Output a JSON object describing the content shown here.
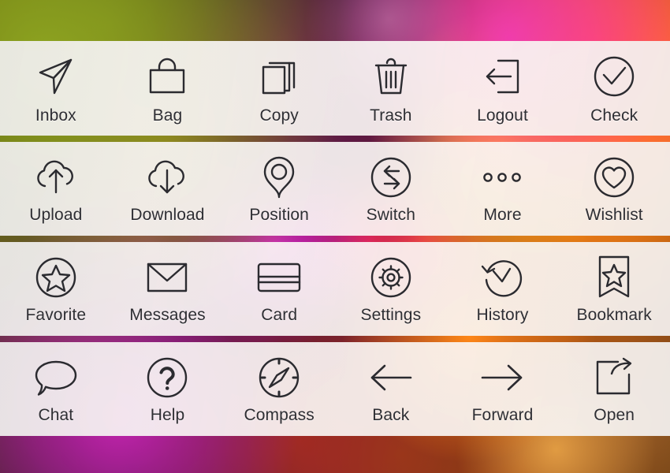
{
  "meta": {
    "background_style": "colorful-bokeh-photo",
    "band_count": 4,
    "columns_per_band": 6,
    "label_color": "#2e2e33",
    "icon_stroke_color": "#2b2b30",
    "band_fill": "#f5f2f0"
  },
  "bands": [
    {
      "id": "band-1",
      "items": [
        {
          "label": "Inbox",
          "icon": "paper-plane-icon"
        },
        {
          "label": "Bag",
          "icon": "shopping-bag-icon"
        },
        {
          "label": "Copy",
          "icon": "copy-pages-icon"
        },
        {
          "label": "Trash",
          "icon": "trash-can-icon"
        },
        {
          "label": "Logout",
          "icon": "logout-arrow-icon"
        },
        {
          "label": "Check",
          "icon": "check-circle-icon"
        }
      ]
    },
    {
      "id": "band-2",
      "items": [
        {
          "label": "Upload",
          "icon": "cloud-upload-icon"
        },
        {
          "label": "Download",
          "icon": "cloud-download-icon"
        },
        {
          "label": "Position",
          "icon": "map-pin-icon"
        },
        {
          "label": "Switch",
          "icon": "switch-arrows-circle-icon"
        },
        {
          "label": "More",
          "icon": "more-dots-icon"
        },
        {
          "label": "Wishlist",
          "icon": "heart-circle-icon"
        }
      ]
    },
    {
      "id": "band-3",
      "items": [
        {
          "label": "Favorite",
          "icon": "star-circle-icon"
        },
        {
          "label": "Messages",
          "icon": "envelope-icon"
        },
        {
          "label": "Card",
          "icon": "credit-card-icon"
        },
        {
          "label": "Settings",
          "icon": "gear-circle-icon"
        },
        {
          "label": "History",
          "icon": "clock-rewind-icon"
        },
        {
          "label": "Bookmark",
          "icon": "bookmark-star-icon"
        }
      ]
    },
    {
      "id": "band-4",
      "items": [
        {
          "label": "Chat",
          "icon": "speech-bubble-icon"
        },
        {
          "label": "Help",
          "icon": "question-circle-icon"
        },
        {
          "label": "Compass",
          "icon": "compass-icon"
        },
        {
          "label": "Back",
          "icon": "arrow-left-icon"
        },
        {
          "label": "Forward",
          "icon": "arrow-right-icon"
        },
        {
          "label": "Open",
          "icon": "open-external-icon"
        }
      ]
    }
  ]
}
